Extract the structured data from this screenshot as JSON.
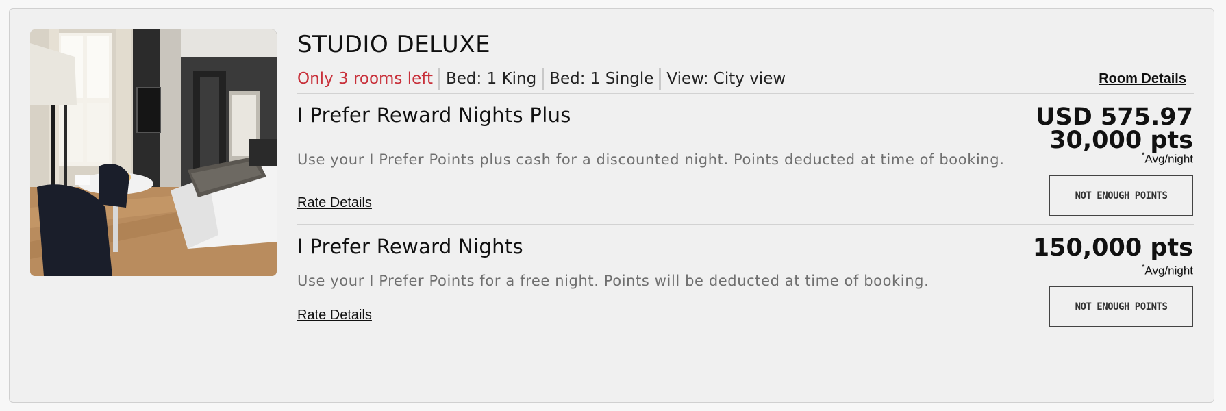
{
  "room": {
    "title": "STUDIO DELUXE",
    "scarcity": "Only 3 rooms left",
    "features": [
      "Bed: 1 King",
      "Bed: 1 Single",
      "View: City view"
    ],
    "details_link": "Room Details",
    "image_alt": "Room photo"
  },
  "rates": [
    {
      "name": "I Prefer Reward Nights Plus",
      "description": "Use your I Prefer Points plus cash for a discounted night. Points deducted at time of booking.",
      "details_link": "Rate Details",
      "price_cash": "USD 575.97",
      "price_points": "30,000 pts",
      "avg_marker": "*",
      "avg_label": "Avg/night",
      "button_label": "NOT ENOUGH POINTS"
    },
    {
      "name": "I Prefer Reward Nights",
      "description": "Use your I Prefer Points for a free night. Points will be deducted at time of booking.",
      "details_link": "Rate Details",
      "price_points": "150,000 pts",
      "avg_marker": "*",
      "avg_label": "Avg/night",
      "button_label": "NOT ENOUGH POINTS"
    }
  ],
  "colors": {
    "scarcity": "#c8303a",
    "card_bg": "#f0f0f0",
    "description_text": "#6f6f6f"
  }
}
